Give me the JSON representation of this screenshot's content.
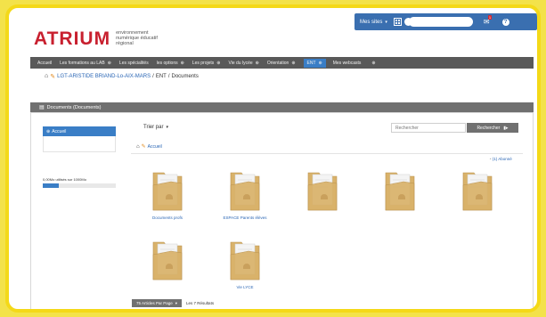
{
  "header": {
    "logo": "ATRIUM",
    "tagline": "environnement numérique éducatif régional"
  },
  "userbar": {
    "my_sites": "Mes sites",
    "arrow": "▾",
    "square_icon": "grid-icon",
    "mail_icon": "mail-icon",
    "mail_badge": "1",
    "help_icon": "?"
  },
  "topnav": {
    "plus": "⊕",
    "items": [
      {
        "label": "Accueil"
      },
      {
        "label": "Les formations au LAB"
      },
      {
        "label": "Les spécialités"
      },
      {
        "label": "les options"
      },
      {
        "label": "Les projets"
      },
      {
        "label": "Vie du lycée"
      },
      {
        "label": "Orientation"
      },
      {
        "label": "ENT",
        "active": true
      },
      {
        "label": "Mes webcasts"
      },
      {
        "label": ""
      }
    ]
  },
  "breadcrumb": {
    "link": "LGT-ARISTIDE BRIAND-Lo-AIX-MARS",
    "sep": "/",
    "middle": "ENT",
    "current": "Documents"
  },
  "panel": {
    "title": "Documents (Documents)"
  },
  "sidebar": {
    "home": "Accueil",
    "quota": "0,00Mo utilisés sur 1000Mo",
    "quota_fraction": 0.22
  },
  "toolbar": {
    "sort": "Trier par",
    "sort_caret": "▾",
    "search_placeholder": "Rechercher",
    "search_button": "Rechercher"
  },
  "sub_breadcrumb": {
    "label": "Accueil"
  },
  "share_link": "(1) Abonné",
  "folders": [
    {
      "label": "Documents profs"
    },
    {
      "label": "ESPACE Parents élèves"
    },
    {
      "label": ""
    },
    {
      "label": ""
    },
    {
      "label": ""
    },
    {
      "label": ""
    },
    {
      "label": "Vie LYCE"
    }
  ],
  "pager": {
    "per_page": "75 Articles Par Page",
    "caret": "▾",
    "count": "Les 7 Résultats"
  },
  "colors": {
    "accent_blue": "#3a7ec6",
    "brand_red": "#c8202f",
    "frame_yellow": "#f4d918",
    "nav_gray": "#595959",
    "folder_tan": "#d9b26a"
  }
}
